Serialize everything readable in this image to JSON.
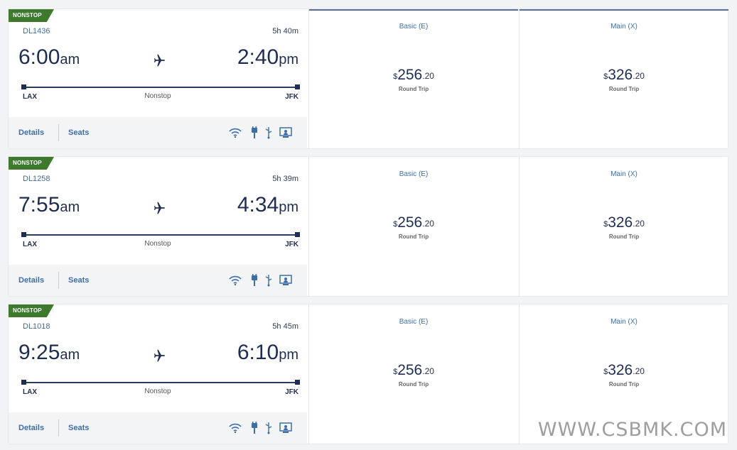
{
  "flights": [
    {
      "badge": "NONSTOP",
      "flight_number": "DL1436",
      "duration": "5h 40m",
      "depart_time": "6:00",
      "depart_ampm": "am",
      "arrive_time": "2:40",
      "arrive_ampm": "pm",
      "origin": "LAX",
      "destination": "JFK",
      "stops": "Nonstop",
      "details_label": "Details",
      "seats_label": "Seats",
      "fares": [
        {
          "name": "Basic (E)",
          "currency": "$",
          "dollars": "256",
          "cents": ".20",
          "trip": "Round Trip"
        },
        {
          "name": "Main (X)",
          "currency": "$",
          "dollars": "326",
          "cents": ".20",
          "trip": "Round Trip"
        }
      ]
    },
    {
      "badge": "NONSTOP",
      "flight_number": "DL1258",
      "duration": "5h 39m",
      "depart_time": "7:55",
      "depart_ampm": "am",
      "arrive_time": "4:34",
      "arrive_ampm": "pm",
      "origin": "LAX",
      "destination": "JFK",
      "stops": "Nonstop",
      "details_label": "Details",
      "seats_label": "Seats",
      "fares": [
        {
          "name": "Basic (E)",
          "currency": "$",
          "dollars": "256",
          "cents": ".20",
          "trip": "Round Trip"
        },
        {
          "name": "Main (X)",
          "currency": "$",
          "dollars": "326",
          "cents": ".20",
          "trip": "Round Trip"
        }
      ]
    },
    {
      "badge": "NONSTOP",
      "flight_number": "DL1018",
      "duration": "5h 45m",
      "depart_time": "9:25",
      "depart_ampm": "am",
      "arrive_time": "6:10",
      "arrive_ampm": "pm",
      "origin": "LAX",
      "destination": "JFK",
      "stops": "Nonstop",
      "details_label": "Details",
      "seats_label": "Seats",
      "fares": [
        {
          "name": "Basic (E)",
          "currency": "$",
          "dollars": "256",
          "cents": ".20",
          "trip": "Round Trip"
        },
        {
          "name": "Main (X)",
          "currency": "$",
          "dollars": "326",
          "cents": ".20",
          "trip": "Round Trip"
        }
      ]
    }
  ],
  "amenities": [
    "wifi-icon",
    "power-icon",
    "usb-icon",
    "entertainment-icon"
  ],
  "watermark": "WWW.CSBMK.COM",
  "colors": {
    "badge": "#3d7a2e",
    "link": "#3e6ea8",
    "time": "#1f2d52",
    "background": "#f1f3f6"
  }
}
